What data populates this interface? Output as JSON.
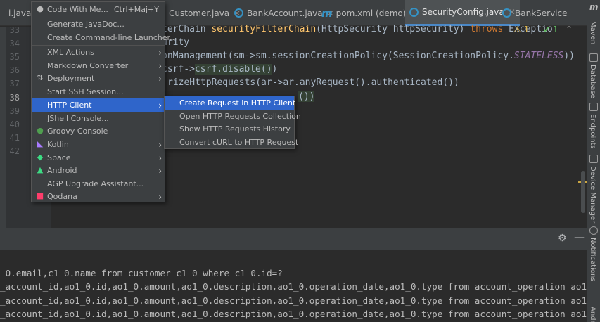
{
  "tabs": [
    {
      "label": "i.java",
      "icon": "none"
    },
    {
      "label": "Customer.java",
      "icon": "class-icon"
    },
    {
      "label": "BankAccount.java",
      "icon": "class-icon"
    },
    {
      "label": "pom.xml (demo)",
      "icon": "maven-icon"
    },
    {
      "label": "SecurityConfig.java",
      "icon": "class-icon",
      "active": true
    },
    {
      "label": "BankService",
      "icon": "class-icon"
    }
  ],
  "editor": {
    "line_numbers": [
      "33",
      "34",
      "35",
      "36",
      "37",
      "38",
      "39",
      "40",
      "41",
      "42"
    ],
    "current_line": "38",
    "code": [
      {
        "t": "terChain ",
        "fn": "securityFilterChain",
        "rest": "(HttpSecurity httpSecurity) ",
        "kw": "throws",
        "tail": " Exceptio"
      },
      {
        "t": "urity"
      },
      {
        "t": "onManagement(sm->sm.sessionCreationPolicy(SessionCreationPolicy.",
        "it": "STATELESS",
        "tail": "))"
      },
      {
        "t": "csrf->",
        "hl": "csrf.disable()",
        "tail": ")"
      },
      {
        "t": "rizeHttpRequests(ar->ar.anyRequest().authenticated())"
      },
      {
        "t": "",
        "hl": "())"
      }
    ],
    "warnings": {
      "warn": "⚠ 1",
      "check": "✔ 1"
    }
  },
  "right_toolbar": [
    {
      "label": "Maven",
      "icon": "maven-icon"
    },
    {
      "label": "Database",
      "icon": "database-icon"
    },
    {
      "label": "Endpoints",
      "icon": "endpoints-icon"
    },
    {
      "label": "Device Manager",
      "icon": "device-icon"
    },
    {
      "label": "Notifications",
      "icon": "bell-icon"
    },
    {
      "label": "Andro",
      "icon": "android-icon"
    }
  ],
  "console": {
    "lines": [
      "_0.email,c1_0.name from customer c1_0 where c1_0.id=?",
      "_account_id,ao1_0.id,ao1_0.amount,ao1_0.description,ao1_0.operation_date,ao1_0.type from account_operation ao1_0 where",
      "_account_id,ao1_0.id,ao1_0.amount,ao1_0.description,ao1_0.operation_date,ao1_0.type from account_operation ao1_0 where",
      "_account_id,ao1_0.id,ao1_0.amount,ao1_0.description,ao1_0.operation_date,ao1_0.type from account_operation ao1_0 where"
    ]
  },
  "context_menu": {
    "items": [
      {
        "label": "Code With Me...",
        "shortcut": "Ctrl+Maj+Y",
        "icon": "person-icon",
        "icon_color": "#bbbbbb"
      },
      {
        "label": "Generate JavaDoc...",
        "sep_before": true
      },
      {
        "label": "Create Command-line Launcher..."
      },
      {
        "label": "XML Actions",
        "submenu": true,
        "sep_before": true
      },
      {
        "label": "Markdown Converter",
        "submenu": true
      },
      {
        "label": "Deployment",
        "submenu": true,
        "icon": "sync-icon",
        "icon_color": "#bbbbbb"
      },
      {
        "label": "Start SSH Session..."
      },
      {
        "label": "HTTP Client",
        "submenu": true,
        "selected": true
      },
      {
        "label": "JShell Console..."
      },
      {
        "label": "Groovy Console",
        "icon": "groovy-icon",
        "icon_color": "#4f9f4f"
      },
      {
        "label": "Kotlin",
        "submenu": true,
        "icon": "kotlin-icon",
        "icon_color": "#a97bff"
      },
      {
        "label": "Space",
        "submenu": true,
        "icon": "space-icon",
        "icon_color": "#3ddc84"
      },
      {
        "label": "Android",
        "submenu": true,
        "icon": "android-icon",
        "icon_color": "#3ddc84"
      },
      {
        "label": "AGP Upgrade Assistant..."
      },
      {
        "label": "Qodana",
        "submenu": true,
        "icon": "qodana-icon",
        "icon_color": "#ff3d6b"
      }
    ]
  },
  "submenu": {
    "items": [
      {
        "label": "Create Request in HTTP Client",
        "selected": true
      },
      {
        "label": "Open HTTP Requests Collection"
      },
      {
        "label": "Show HTTP Requests History"
      },
      {
        "label": "Convert cURL to HTTP Request"
      }
    ]
  }
}
